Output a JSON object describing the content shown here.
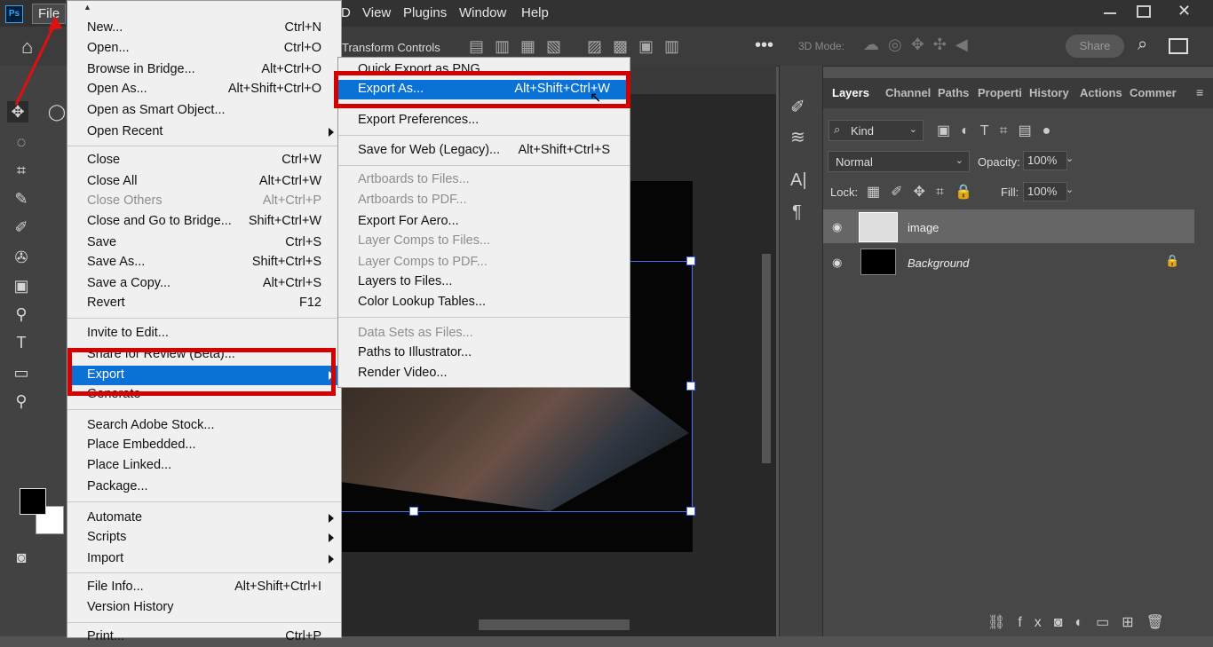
{
  "app": {
    "logo": "Ps"
  },
  "menubar": {
    "items": [
      "File",
      "D",
      "View",
      "Plugins",
      "Window",
      "Help"
    ]
  },
  "options_bar": {
    "transform_controls": "Transform Controls",
    "mode_3d": "3D Mode:",
    "share": "Share"
  },
  "file_menu": {
    "items": [
      {
        "label": "New...",
        "shortcut": "Ctrl+N"
      },
      {
        "label": "Open...",
        "shortcut": "Ctrl+O"
      },
      {
        "label": "Browse in Bridge...",
        "shortcut": "Alt+Ctrl+O"
      },
      {
        "label": "Open As...",
        "shortcut": "Alt+Shift+Ctrl+O"
      },
      {
        "label": "Open as Smart Object...",
        "shortcut": ""
      },
      {
        "label": "Open Recent",
        "shortcut": ""
      },
      {
        "label": "Close",
        "shortcut": "Ctrl+W"
      },
      {
        "label": "Close All",
        "shortcut": "Alt+Ctrl+W"
      },
      {
        "label": "Close Others",
        "shortcut": "Alt+Ctrl+P"
      },
      {
        "label": "Close and Go to Bridge...",
        "shortcut": "Shift+Ctrl+W"
      },
      {
        "label": "Save",
        "shortcut": "Ctrl+S"
      },
      {
        "label": "Save As...",
        "shortcut": "Shift+Ctrl+S"
      },
      {
        "label": "Save a Copy...",
        "shortcut": "Alt+Ctrl+S"
      },
      {
        "label": "Revert",
        "shortcut": "F12"
      },
      {
        "label": "Invite to Edit...",
        "shortcut": ""
      },
      {
        "label": "Share for Review (Beta)...",
        "shortcut": ""
      },
      {
        "label": "Export",
        "shortcut": ""
      },
      {
        "label": "Generate",
        "shortcut": ""
      },
      {
        "label": "Search Adobe Stock...",
        "shortcut": ""
      },
      {
        "label": "Place Embedded...",
        "shortcut": ""
      },
      {
        "label": "Place Linked...",
        "shortcut": ""
      },
      {
        "label": "Package...",
        "shortcut": ""
      },
      {
        "label": "Automate",
        "shortcut": ""
      },
      {
        "label": "Scripts",
        "shortcut": ""
      },
      {
        "label": "Import",
        "shortcut": ""
      },
      {
        "label": "File Info...",
        "shortcut": "Alt+Shift+Ctrl+I"
      },
      {
        "label": "Version History",
        "shortcut": ""
      },
      {
        "label": "Print...",
        "shortcut": "Ctrl+P"
      }
    ]
  },
  "export_menu": {
    "items": [
      {
        "label": "Quick Export as PNG",
        "shortcut": ""
      },
      {
        "label": "Export As...",
        "shortcut": "Alt+Shift+Ctrl+W"
      },
      {
        "label": "Export Preferences...",
        "shortcut": ""
      },
      {
        "label": "Save for Web (Legacy)...",
        "shortcut": "Alt+Shift+Ctrl+S"
      },
      {
        "label": "Artboards to Files...",
        "shortcut": ""
      },
      {
        "label": "Artboards to PDF...",
        "shortcut": ""
      },
      {
        "label": "Export For Aero...",
        "shortcut": ""
      },
      {
        "label": "Layer Comps to Files...",
        "shortcut": ""
      },
      {
        "label": "Layer Comps to PDF...",
        "shortcut": ""
      },
      {
        "label": "Layers to Files...",
        "shortcut": ""
      },
      {
        "label": "Color Lookup Tables...",
        "shortcut": ""
      },
      {
        "label": "Data Sets as Files...",
        "shortcut": ""
      },
      {
        "label": "Paths to Illustrator...",
        "shortcut": ""
      },
      {
        "label": "Render Video...",
        "shortcut": ""
      }
    ]
  },
  "layers_panel": {
    "tabs": [
      "Layers",
      "Channel",
      "Paths",
      "Properti",
      "History",
      "Actions",
      "Commer"
    ],
    "kind": "Kind",
    "blend_mode": "Normal",
    "opacity_label": "Opacity:",
    "opacity_value": "100%",
    "lock_label": "Lock:",
    "fill_label": "Fill:",
    "fill_value": "100%",
    "layers": [
      {
        "name": "image"
      },
      {
        "name": "Background"
      }
    ]
  },
  "colors": {
    "highlight": "#0a72d6",
    "red_annotation": "#d40000"
  }
}
